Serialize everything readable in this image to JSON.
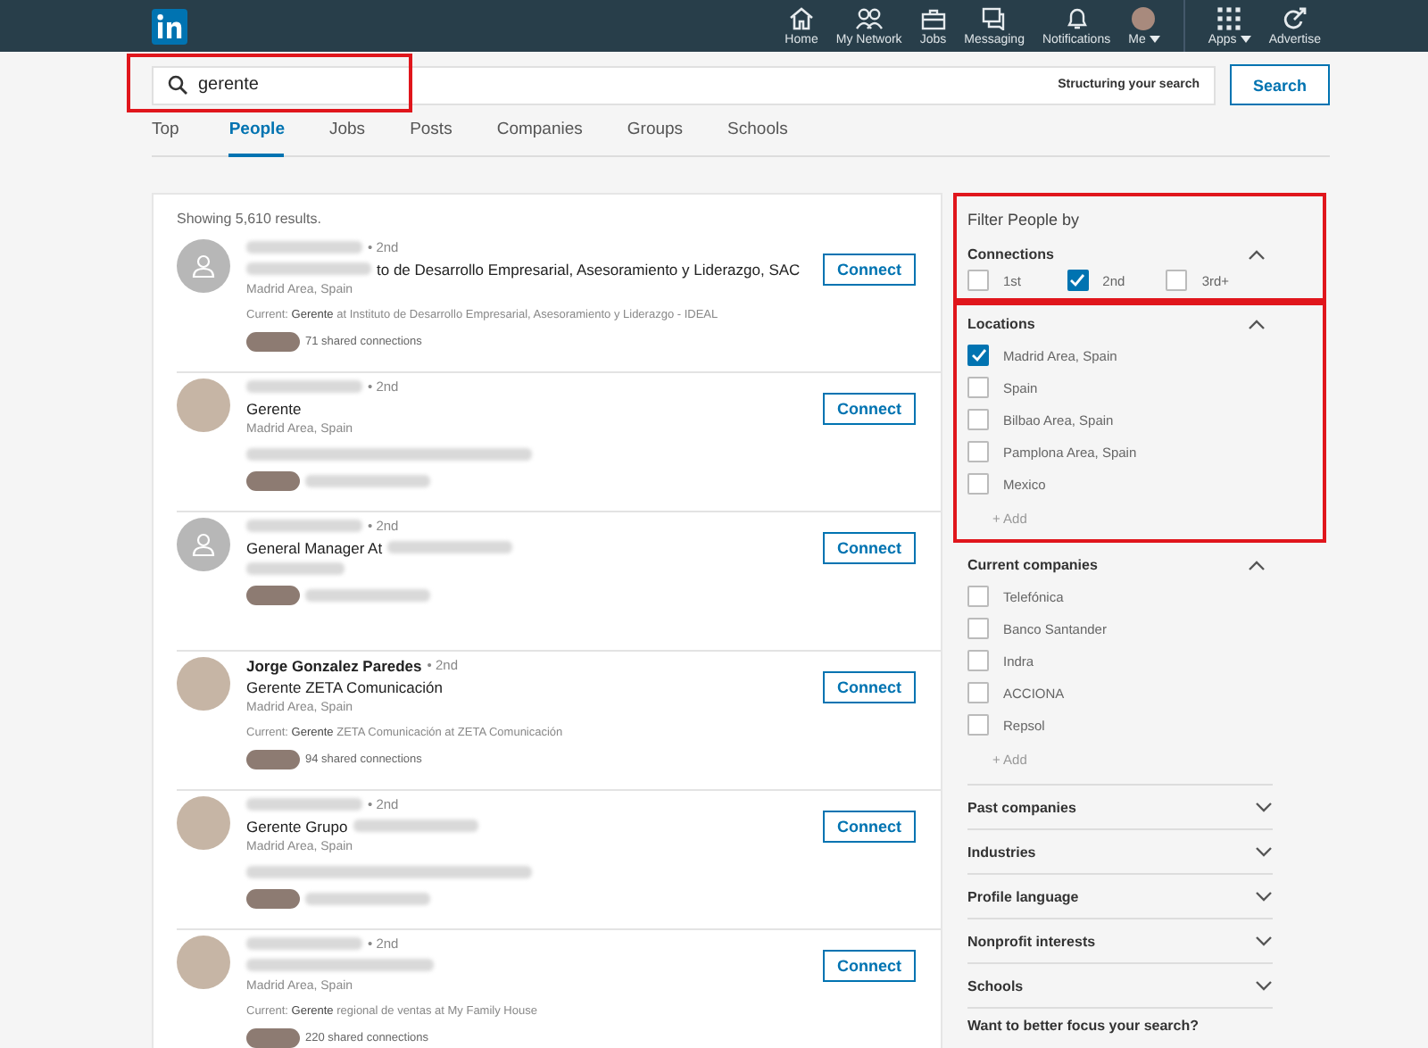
{
  "nav": {
    "items": [
      {
        "kind": "home",
        "label": "Home",
        "caret": false
      },
      {
        "kind": "network",
        "label": "My Network",
        "caret": false
      },
      {
        "kind": "jobs",
        "label": "Jobs",
        "caret": false
      },
      {
        "kind": "messaging",
        "label": "Messaging",
        "caret": false
      },
      {
        "kind": "bell",
        "label": "Notifications",
        "caret": false
      },
      {
        "kind": "avatar",
        "label": "Me",
        "caret": true
      },
      {
        "kind": "grid",
        "label": "Apps",
        "caret": true
      },
      {
        "kind": "advertise",
        "label": "Advertise",
        "caret": false
      }
    ]
  },
  "search": {
    "value": "gerente",
    "highlighted": true,
    "hint": "Structuring your search",
    "button": "Search"
  },
  "tabs": [
    {
      "label": "Top",
      "selected": false
    },
    {
      "label": "People",
      "selected": true
    },
    {
      "label": "Jobs",
      "selected": false
    },
    {
      "label": "Posts",
      "selected": false
    },
    {
      "label": "Companies",
      "selected": false
    },
    {
      "label": "Groups",
      "selected": false
    },
    {
      "label": "Schools",
      "selected": false
    }
  ],
  "results": {
    "count": "Showing 5,610 results.",
    "items": [
      {
        "avatar_photo": false,
        "name_blurred": true,
        "degree": "• 2nd",
        "headline_prefix_blurred": true,
        "headline": "to de Desarrollo Empresarial, Asesoramiento y Liderazgo, SAC",
        "location": "Madrid Area, Spain",
        "current": "Current: **Gerente** at Instituto de Desarrollo Empresarial, Asesoramiento y Liderazgo - IDEAL",
        "shared": "71 shared connections",
        "button": "Connect"
      },
      {
        "avatar_photo": true,
        "name_blurred": true,
        "degree": "• 2nd",
        "headline": "Gerente",
        "location": "Madrid Area, Spain",
        "current_blurred": true,
        "shared_blurred": true,
        "button": "Connect"
      },
      {
        "avatar_photo": false,
        "name_blurred": true,
        "degree": "• 2nd",
        "headline": "General Manager At",
        "headline_suffix_blurred": true,
        "location_blurred": true,
        "shared_blurred": true,
        "button": "Connect"
      },
      {
        "avatar_photo": true,
        "name": "Jorge Gonzalez Paredes",
        "degree": "• 2nd",
        "headline": "Gerente ZETA Comunicación",
        "location": "Madrid Area, Spain",
        "current": "Current: **Gerente** ZETA Comunicación at ZETA Comunicación",
        "shared": "94 shared connections",
        "button": "Connect"
      },
      {
        "avatar_photo": true,
        "name_blurred": true,
        "degree": "• 2nd",
        "headline": "Gerente Grupo",
        "headline_suffix_blurred": true,
        "location": "Madrid Area, Spain",
        "current_blurred": true,
        "shared_blurred": true,
        "button": "Connect"
      },
      {
        "avatar_photo": true,
        "name_blurred": true,
        "degree": "• 2nd",
        "headline_blurred": true,
        "location": "Madrid Area, Spain",
        "current": "Current: **Gerente** regional de ventas at My Family House",
        "shared": "220 shared connections",
        "button": "Connect"
      }
    ]
  },
  "filters": {
    "title": "Filter People by",
    "connections": {
      "title": "Connections",
      "highlighted": true,
      "options": [
        {
          "label": "1st",
          "checked": false
        },
        {
          "label": "2nd",
          "checked": true
        },
        {
          "label": "3rd+",
          "checked": false
        }
      ]
    },
    "locations": {
      "title": "Locations",
      "highlighted": true,
      "options": [
        {
          "label": "Madrid Area, Spain",
          "checked": true
        },
        {
          "label": "Spain",
          "checked": false
        },
        {
          "label": "Bilbao Area, Spain",
          "checked": false
        },
        {
          "label": "Pamplona Area, Spain",
          "checked": false
        },
        {
          "label": "Mexico",
          "checked": false
        }
      ],
      "add": "+ Add"
    },
    "companies": {
      "title": "Current companies",
      "highlighted": false,
      "options": [
        {
          "label": "Telefónica",
          "checked": false
        },
        {
          "label": "Banco Santander",
          "checked": false
        },
        {
          "label": "Indra",
          "checked": false
        },
        {
          "label": "ACCIONA",
          "checked": false
        },
        {
          "label": "Repsol",
          "checked": false
        }
      ],
      "add": "+ Add"
    },
    "collapsed": [
      "Past companies",
      "Industries",
      "Profile language",
      "Nonprofit interests",
      "Schools"
    ],
    "footer": "Want to better focus your search?"
  }
}
